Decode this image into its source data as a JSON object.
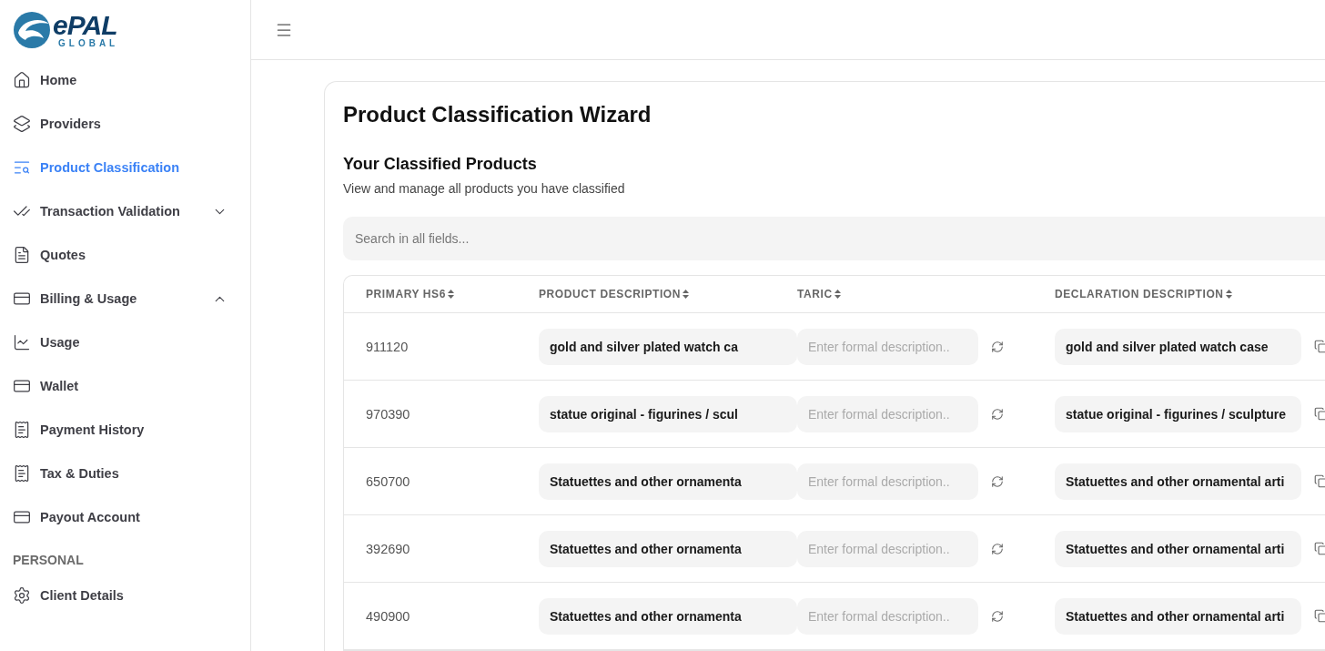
{
  "logo": {
    "wordmark": "ePAL",
    "tagline": "GLOBAL"
  },
  "sidebar": {
    "items": [
      {
        "label": "Home",
        "selected": false
      },
      {
        "label": "Providers",
        "selected": false
      },
      {
        "label": "Product Classification",
        "selected": true
      },
      {
        "label": "Transaction Validation",
        "selected": false,
        "expanded": false
      },
      {
        "label": "Quotes",
        "selected": false
      },
      {
        "label": "Billing & Usage",
        "selected": false,
        "expanded": true
      },
      {
        "label": "Usage",
        "selected": false
      },
      {
        "label": "Wallet",
        "selected": false
      },
      {
        "label": "Payment History",
        "selected": false
      },
      {
        "label": "Tax & Duties",
        "selected": false
      },
      {
        "label": "Payout Account",
        "selected": false
      }
    ],
    "section": {
      "title": "PERSONAL",
      "items": [
        {
          "label": "Client Details",
          "selected": false
        }
      ]
    }
  },
  "page": {
    "title": "Product Classification Wizard",
    "subtitle": "Your Classified Products",
    "description": "View and manage all products you have classified",
    "search": {
      "placeholder": "Search in all fields..."
    }
  },
  "table": {
    "columns": [
      "PRIMARY HS6",
      "PRODUCT DESCRIPTION",
      "TARIC",
      "DECLARATION DESCRIPTION"
    ],
    "rows": [
      {
        "hs6": "911120",
        "product": "gold and silver plated watch ca",
        "taric_placeholder": "Enter formal description..",
        "declaration": "gold and silver plated watch case"
      },
      {
        "hs6": "970390",
        "product": "statue original - figurines / scul",
        "taric_placeholder": "Enter formal description..",
        "declaration": "statue original - figurines / sculpture"
      },
      {
        "hs6": "650700",
        "product": "Statuettes and other ornamenta",
        "taric_placeholder": "Enter formal description..",
        "declaration": "Statuettes and other ornamental arti"
      },
      {
        "hs6": "392690",
        "product": "Statuettes and other ornamenta",
        "taric_placeholder": "Enter formal description..",
        "declaration": "Statuettes and other ornamental arti"
      },
      {
        "hs6": "490900",
        "product": "Statuettes and other ornamenta",
        "taric_placeholder": "Enter formal description..",
        "declaration": "Statuettes and other ornamental arti"
      }
    ]
  }
}
